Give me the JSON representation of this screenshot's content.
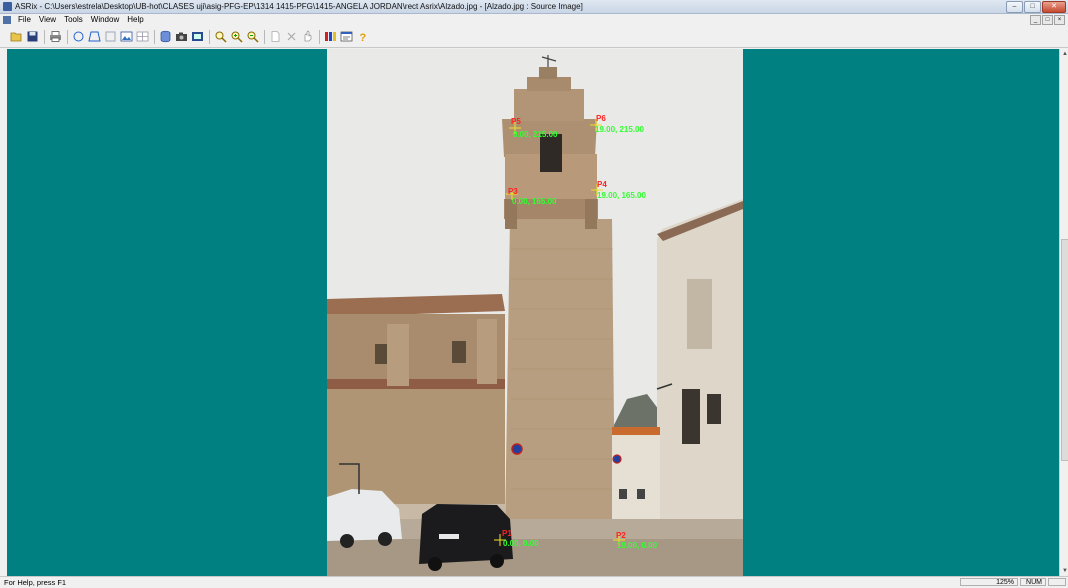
{
  "window": {
    "title": "ASRix - C:\\Users\\estrela\\Desktop\\UB-hot\\CLASES uji\\asig-PFG-EP\\1314 1415-PFG\\1415-ANGELA JORDAN\\rect Asrix\\Alzado.jpg - [Alzado.jpg : Source Image]",
    "min_label": "–",
    "max_label": "□",
    "close_label": "✕",
    "mdi_min": "_",
    "mdi_restore": "□",
    "mdi_close": "×"
  },
  "menu": {
    "items": [
      "File",
      "View",
      "Tools",
      "Window",
      "Help"
    ]
  },
  "toolbar": {
    "buttons": [
      "open-icon",
      "save-icon",
      "print-icon",
      "circle-tool-icon",
      "polygon-tool-icon",
      "rectangle-tool-icon",
      "image-icon",
      "grid-icon",
      "database-icon",
      "camera-icon",
      "photo-icon",
      "zoom-fit-icon",
      "zoom-in-icon",
      "zoom-out-icon",
      "new-icon",
      "delete-icon",
      "hand-icon",
      "color-bars-icon",
      "properties-icon",
      "help-icon"
    ]
  },
  "points": [
    {
      "id": "P5",
      "coords": "0.00, 215.00"
    },
    {
      "id": "P6",
      "coords": "19.00, 215.00"
    },
    {
      "id": "P3",
      "coords": "0.00, 165.00"
    },
    {
      "id": "P4",
      "coords": "19.00, 165.00"
    },
    {
      "id": "P1",
      "coords": "0.00, 0.00"
    },
    {
      "id": "P2",
      "coords": "19.00, 0.00"
    }
  ],
  "status": {
    "help": "For Help, press F1",
    "zoom": "125%",
    "num": "NUM"
  },
  "colors": {
    "workspace": "#008080",
    "point_label": "#ff2020",
    "coord_label": "#32ff32"
  }
}
